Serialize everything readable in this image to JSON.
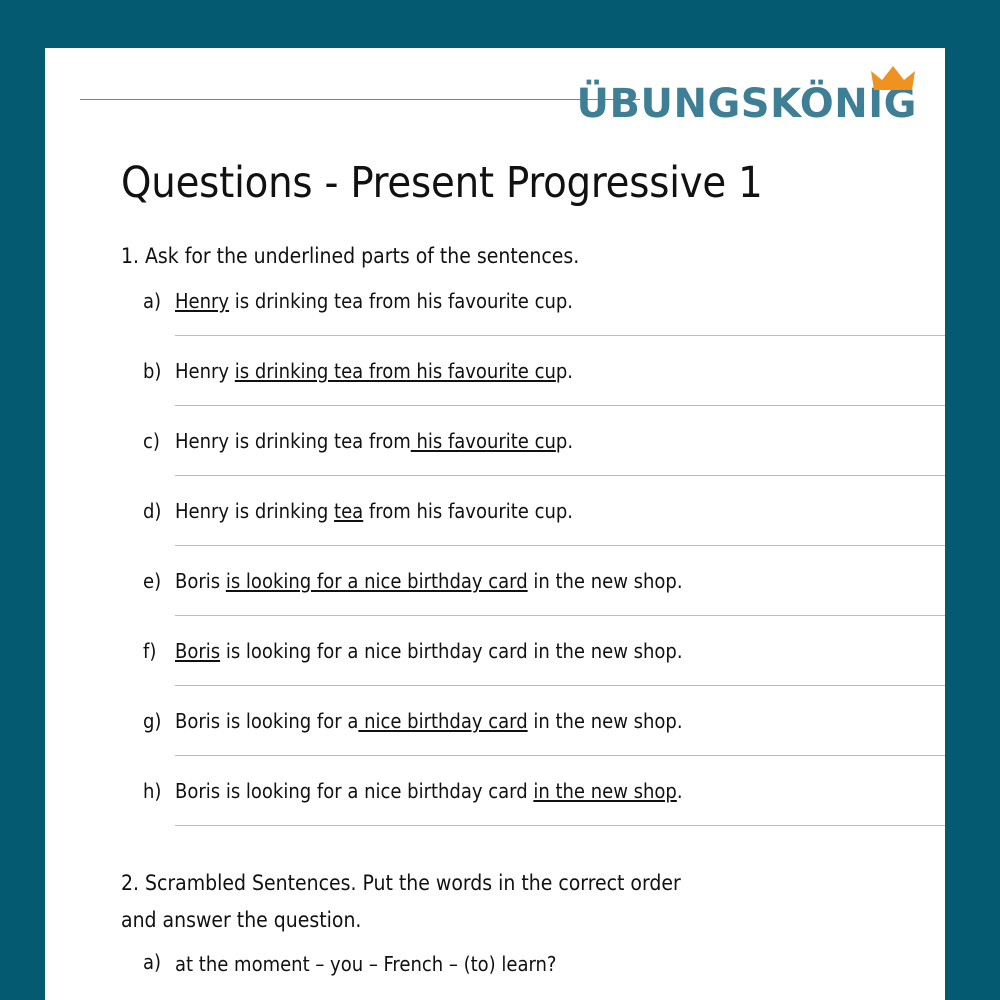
{
  "page": {
    "background_color": "#045a70",
    "sheet_color": "#ffffff"
  },
  "header": {
    "rule_color": "#5b8ea3",
    "brand_name": "ÜBUNGSKÖNIG",
    "brand_color": "#3f7f96",
    "crown_color": "#f0921f",
    "crown_icon": "crown-icon"
  },
  "title": "Questions - Present Progressive 1",
  "exercises": [
    {
      "number": "1.",
      "instruction": "1. Ask for the underlined parts of the sentences.",
      "items": [
        {
          "label": "a)",
          "text": "Henry is drinking tea from his favourite cup.",
          "underline_start": 0,
          "underline_end": 5,
          "has_answer_line": true
        },
        {
          "label": "b)",
          "text": "Henry is drinking tea from his favourite cup.",
          "underline_start": 6,
          "underline_end": 43,
          "has_answer_line": true
        },
        {
          "label": "c)",
          "text": "Henry is drinking tea from his favourite cup.",
          "underline_start": 26,
          "underline_end": 43,
          "has_answer_line": true
        },
        {
          "label": "d)",
          "text": "Henry is drinking tea from his favourite cup.",
          "underline_start": 18,
          "underline_end": 21,
          "has_answer_line": true
        },
        {
          "label": "e)",
          "text": "Boris is looking for a nice birthday card in the new shop.",
          "underline_start": 6,
          "underline_end": 41,
          "has_answer_line": true
        },
        {
          "label": "f)",
          "text": "Boris is looking for a nice birthday card in the new shop.",
          "underline_start": 0,
          "underline_end": 5,
          "has_answer_line": true
        },
        {
          "label": "g)",
          "text": "Boris is looking for a nice birthday card in the new shop.",
          "underline_start": 22,
          "underline_end": 41,
          "has_answer_line": true
        },
        {
          "label": "h)",
          "text": "Boris is looking for a nice birthday card in the new shop.",
          "underline_start": 42,
          "underline_end": 57,
          "has_answer_line": true
        }
      ]
    },
    {
      "number": "2.",
      "instruction": "2. Scrambled Sentences. Put the words in the correct order and answer the question.",
      "items": [
        {
          "label": "a)",
          "text": "at the moment – you – French – (to) learn?",
          "underline_start": null,
          "underline_end": null,
          "has_answer_line": false
        }
      ]
    }
  ]
}
